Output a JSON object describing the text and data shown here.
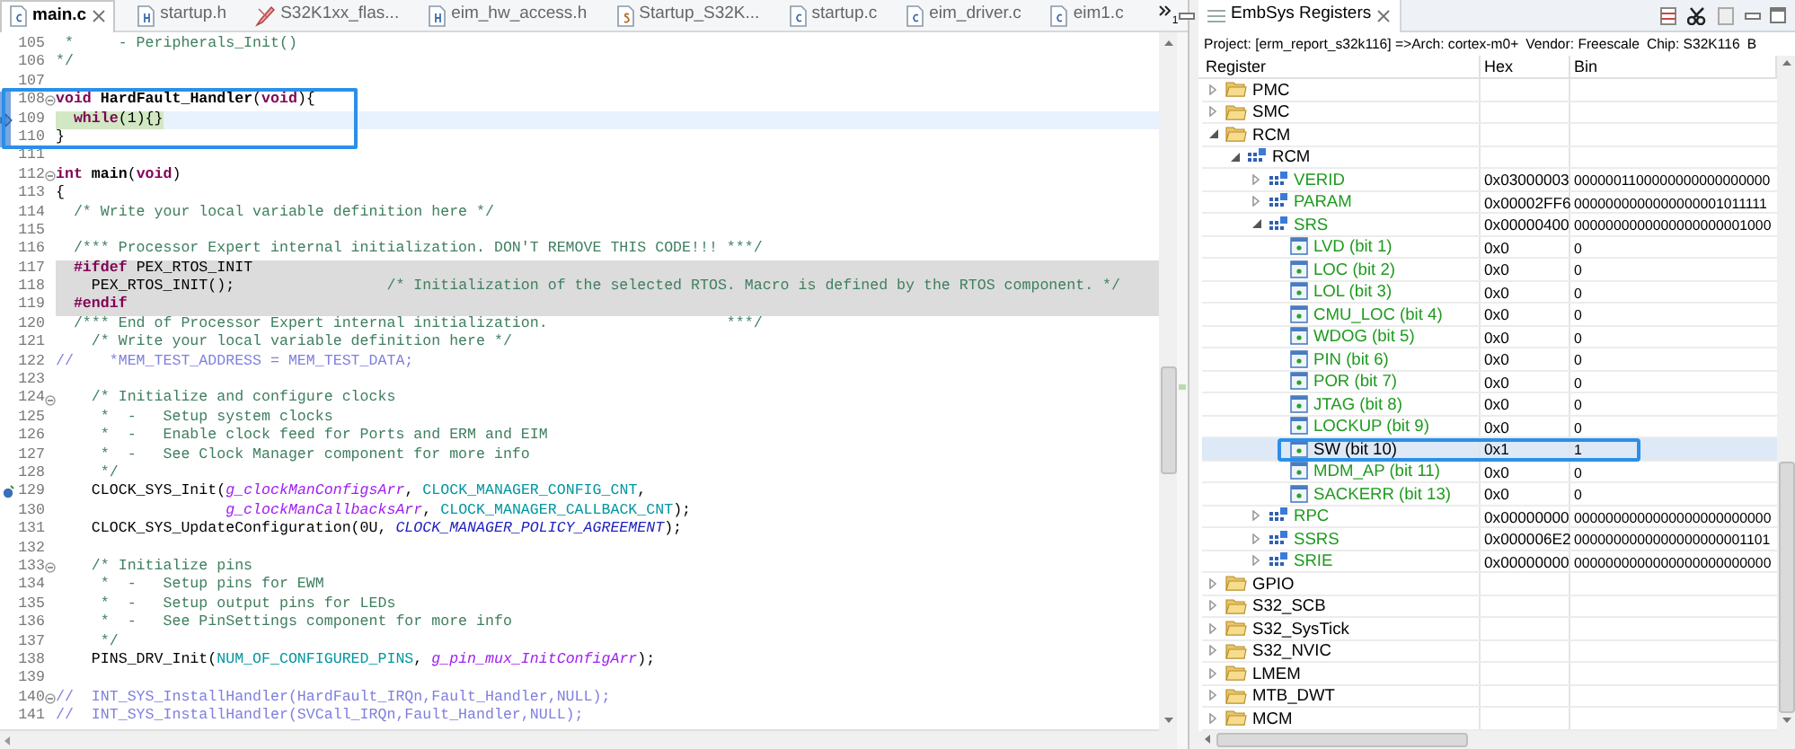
{
  "editor": {
    "tabs": [
      {
        "label": "main.c",
        "kind": "c",
        "selected": true
      },
      {
        "label": "startup.h",
        "kind": "h",
        "selected": false
      },
      {
        "label": "S32K1xx_flas...",
        "kind": "ld",
        "selected": false
      },
      {
        "label": "eim_hw_access.h",
        "kind": "h",
        "selected": false
      },
      {
        "label": "Startup_S32K...",
        "kind": "s",
        "selected": false
      },
      {
        "label": "startup.c",
        "kind": "c",
        "selected": false
      },
      {
        "label": "eim_driver.c",
        "kind": "c",
        "selected": false
      },
      {
        "label": "eim1.c",
        "kind": "c",
        "selected": false
      }
    ],
    "overflow_count": "1",
    "lines": [
      {
        "n": "105",
        "kind": "plain",
        "fold": false,
        "marked": false,
        "tokens": [
          {
            "t": " *     - Peripherals_Init()",
            "kind": "comment"
          }
        ]
      },
      {
        "n": "106",
        "kind": "plain",
        "fold": false,
        "marked": false,
        "tokens": [
          {
            "t": "*/",
            "kind": "comment"
          }
        ]
      },
      {
        "n": "107",
        "kind": "plain",
        "fold": false,
        "marked": false
      },
      {
        "n": "108",
        "kind": "plain",
        "fold": true,
        "marked": true,
        "tokens": [
          {
            "t": "void",
            "kind": "kw"
          },
          {
            "t": " HardFault_Handler",
            "kind": "fn"
          },
          {
            "t": "(",
            "kind": "plain"
          },
          {
            "t": "void",
            "kind": "kw"
          },
          {
            "t": "){",
            "kind": "plain"
          }
        ]
      },
      {
        "n": "109",
        "kind": "current",
        "fold": false,
        "marked": true,
        "marker": {
          "kind": "pointer"
        },
        "tokens": [
          {
            "t": "  while",
            "kind": "kw"
          },
          {
            "t": "(1){}",
            "kind": "plain"
          }
        ]
      },
      {
        "n": "110",
        "kind": "plain",
        "fold": false,
        "marked": true,
        "tokens": [
          {
            "t": "}",
            "kind": "plain"
          }
        ]
      },
      {
        "n": "111",
        "kind": "plain",
        "fold": false,
        "marked": false
      },
      {
        "n": "112",
        "kind": "plain",
        "fold": true,
        "marked": false,
        "tokens": [
          {
            "t": "int",
            "kind": "kw"
          },
          {
            "t": " main",
            "kind": "fn"
          },
          {
            "t": "(",
            "kind": "plain"
          },
          {
            "t": "void",
            "kind": "kw"
          },
          {
            "t": ")",
            "kind": "plain"
          }
        ]
      },
      {
        "n": "113",
        "kind": "plain",
        "fold": false,
        "marked": false,
        "tokens": [
          {
            "t": "{",
            "kind": "plain"
          }
        ]
      },
      {
        "n": "114",
        "kind": "plain",
        "fold": false,
        "marked": false,
        "tokens": [
          {
            "t": "  /* Write your local variable definition here */",
            "kind": "comment"
          }
        ]
      },
      {
        "n": "115",
        "kind": "plain",
        "fold": false,
        "marked": false
      },
      {
        "n": "116",
        "kind": "plain",
        "fold": false,
        "marked": false,
        "tokens": [
          {
            "t": "  /*** Processor Expert internal initialization. DON'T REMOVE THIS CODE!!! ***/",
            "kind": "comment"
          }
        ]
      },
      {
        "n": "117",
        "kind": "inactive",
        "fold": false,
        "marked": false,
        "tokens": [
          {
            "t": "  #ifdef",
            "kind": "pre"
          },
          {
            "t": " PEX_RTOS_INIT",
            "kind": "plain"
          }
        ]
      },
      {
        "n": "118",
        "kind": "inactive",
        "fold": false,
        "marked": false,
        "tokens": [
          {
            "t": "    PEX_RTOS_INIT();                 ",
            "kind": "plain"
          },
          {
            "t": "/* Initialization of the selected RTOS. Macro is defined by the RTOS component. */",
            "kind": "comment"
          }
        ]
      },
      {
        "n": "119",
        "kind": "inactive",
        "fold": false,
        "marked": false,
        "tokens": [
          {
            "t": "  #endif",
            "kind": "pre"
          }
        ]
      },
      {
        "n": "120",
        "kind": "plain",
        "fold": false,
        "marked": false,
        "tokens": [
          {
            "t": "  /*** End of Processor Expert internal initialization.                    ***/",
            "kind": "comment"
          }
        ]
      },
      {
        "n": "121",
        "kind": "plain",
        "fold": false,
        "marked": false,
        "tokens": [
          {
            "t": "    /* Write your local variable definition here */",
            "kind": "comment"
          }
        ]
      },
      {
        "n": "122",
        "kind": "plain",
        "fold": false,
        "marked": false,
        "tokens": [
          {
            "t": "//    *MEM_TEST_ADDRESS = MEM_TEST_DATA;",
            "kind": "linecomment"
          }
        ]
      },
      {
        "n": "123",
        "kind": "plain",
        "fold": false,
        "marked": false
      },
      {
        "n": "124",
        "kind": "plain",
        "fold": true,
        "marked": false,
        "tokens": [
          {
            "t": "    /* Initialize and configure clocks",
            "kind": "comment"
          }
        ]
      },
      {
        "n": "125",
        "kind": "plain",
        "fold": false,
        "marked": false,
        "tokens": [
          {
            "t": "     *  -   Setup system clocks",
            "kind": "comment"
          }
        ]
      },
      {
        "n": "126",
        "kind": "plain",
        "fold": false,
        "marked": false,
        "tokens": [
          {
            "t": "     *  -   Enable clock feed for Ports and ERM and EIM",
            "kind": "comment"
          }
        ]
      },
      {
        "n": "127",
        "kind": "plain",
        "fold": false,
        "marked": false,
        "tokens": [
          {
            "t": "     *  -   See Clock Manager component for more info",
            "kind": "comment"
          }
        ]
      },
      {
        "n": "128",
        "kind": "plain",
        "fold": false,
        "marked": false,
        "tokens": [
          {
            "t": "     */",
            "kind": "comment"
          }
        ]
      },
      {
        "n": "129",
        "kind": "plain",
        "fold": false,
        "marked": false,
        "marker": {
          "kind": "breakpoint"
        },
        "tokens": [
          {
            "t": "    CLOCK_SYS_Init(",
            "kind": "plain"
          },
          {
            "t": "g_clockManConfigsArr",
            "kind": "gvar"
          },
          {
            "t": ", ",
            "kind": "plain"
          },
          {
            "t": "CLOCK_MANAGER_CONFIG_CNT",
            "kind": "macro"
          },
          {
            "t": ",",
            "kind": "plain"
          }
        ]
      },
      {
        "n": "130",
        "kind": "plain",
        "fold": false,
        "marked": false,
        "tokens": [
          {
            "t": "                   g_clockManCallbacksArr",
            "kind": "gvar"
          },
          {
            "t": ", ",
            "kind": "plain"
          },
          {
            "t": "CLOCK_MANAGER_CALLBACK_CNT",
            "kind": "macro"
          },
          {
            "t": ");",
            "kind": "plain"
          }
        ]
      },
      {
        "n": "131",
        "kind": "plain",
        "fold": false,
        "marked": false,
        "tokens": [
          {
            "t": "    CLOCK_SYS_UpdateConfiguration(0U, ",
            "kind": "plain"
          },
          {
            "t": "CLOCK_MANAGER_POLICY_AGREEMENT",
            "kind": "enum"
          },
          {
            "t": ");",
            "kind": "plain"
          }
        ]
      },
      {
        "n": "132",
        "kind": "plain",
        "fold": false,
        "marked": false
      },
      {
        "n": "133",
        "kind": "plain",
        "fold": true,
        "marked": false,
        "tokens": [
          {
            "t": "    /* Initialize pins",
            "kind": "comment"
          }
        ]
      },
      {
        "n": "134",
        "kind": "plain",
        "fold": false,
        "marked": false,
        "tokens": [
          {
            "t": "     *  -   Setup pins for EWM",
            "kind": "comment"
          }
        ]
      },
      {
        "n": "135",
        "kind": "plain",
        "fold": false,
        "marked": false,
        "tokens": [
          {
            "t": "     *  -   Setup output pins for LEDs",
            "kind": "comment"
          }
        ]
      },
      {
        "n": "136",
        "kind": "plain",
        "fold": false,
        "marked": false,
        "tokens": [
          {
            "t": "     *  -   See PinSettings component for more info",
            "kind": "comment"
          }
        ]
      },
      {
        "n": "137",
        "kind": "plain",
        "fold": false,
        "marked": false,
        "tokens": [
          {
            "t": "     */",
            "kind": "comment"
          }
        ]
      },
      {
        "n": "138",
        "kind": "plain",
        "fold": false,
        "marked": false,
        "tokens": [
          {
            "t": "    PINS_DRV_Init(",
            "kind": "plain"
          },
          {
            "t": "NUM_OF_CONFIGURED_PINS",
            "kind": "macro"
          },
          {
            "t": ", ",
            "kind": "plain"
          },
          {
            "t": "g_pin_mux_InitConfigArr",
            "kind": "gvar"
          },
          {
            "t": ");",
            "kind": "plain"
          }
        ]
      },
      {
        "n": "139",
        "kind": "plain",
        "fold": false,
        "marked": false
      },
      {
        "n": "140",
        "kind": "plain",
        "fold": true,
        "marked": false,
        "tokens": [
          {
            "t": "//  INT_SYS_InstallHandler(HardFault_IRQn,Fault_Handler,NULL);",
            "kind": "linecomment"
          }
        ]
      },
      {
        "n": "141",
        "kind": "plain",
        "fold": false,
        "marked": false,
        "tokens": [
          {
            "t": "//  INT_SYS_InstallHandler(SVCall_IRQn,Fault_Handler,NULL);",
            "kind": "linecomment"
          }
        ]
      }
    ]
  },
  "registers": {
    "title": "EmbSys Registers",
    "info": [
      "Project: [erm_report_s32k116] =>Arch: cortex-m0+",
      "Vendor: Freescale",
      "Chip: S32K116",
      "B"
    ],
    "columns": [
      "Register",
      "Hex",
      "Bin"
    ],
    "tree": [
      {
        "name": "PMC",
        "kind": "folder",
        "expanded": false,
        "selected": false
      },
      {
        "name": "SMC",
        "kind": "folder",
        "expanded": false,
        "selected": false
      },
      {
        "name": "RCM",
        "kind": "folder",
        "expanded": true,
        "selected": false,
        "children": [
          {
            "name": "RCM",
            "kind": "peripheral",
            "expanded": true,
            "selected": false,
            "children": [
              {
                "name": "VERID",
                "kind": "register",
                "expanded": false,
                "selected": false,
                "hex": "0x03000003",
                "bin": "0000001100000000000000000"
              },
              {
                "name": "PARAM",
                "kind": "register",
                "expanded": false,
                "selected": false,
                "hex": "0x00002FF6",
                "bin": "0000000000000000001011111"
              },
              {
                "name": "SRS",
                "kind": "register",
                "expanded": true,
                "selected": false,
                "hex": "0x00000400",
                "bin": "0000000000000000000001000",
                "children": [
                  {
                    "name": "LVD (bit 1)",
                    "kind": "field",
                    "selected": false,
                    "hex": "0x0",
                    "bin": "0"
                  },
                  {
                    "name": "LOC (bit 2)",
                    "kind": "field",
                    "selected": false,
                    "hex": "0x0",
                    "bin": "0"
                  },
                  {
                    "name": "LOL (bit 3)",
                    "kind": "field",
                    "selected": false,
                    "hex": "0x0",
                    "bin": "0"
                  },
                  {
                    "name": "CMU_LOC (bit 4)",
                    "kind": "field",
                    "selected": false,
                    "hex": "0x0",
                    "bin": "0"
                  },
                  {
                    "name": "WDOG (bit 5)",
                    "kind": "field",
                    "selected": false,
                    "hex": "0x0",
                    "bin": "0"
                  },
                  {
                    "name": "PIN (bit 6)",
                    "kind": "field",
                    "selected": false,
                    "hex": "0x0",
                    "bin": "0"
                  },
                  {
                    "name": "POR (bit 7)",
                    "kind": "field",
                    "selected": false,
                    "hex": "0x0",
                    "bin": "0"
                  },
                  {
                    "name": "JTAG (bit 8)",
                    "kind": "field",
                    "selected": false,
                    "hex": "0x0",
                    "bin": "0"
                  },
                  {
                    "name": "LOCKUP (bit 9)",
                    "kind": "field",
                    "selected": false,
                    "hex": "0x0",
                    "bin": "0"
                  },
                  {
                    "name": "SW (bit 10)",
                    "kind": "field",
                    "selected": true,
                    "hex": "0x1",
                    "bin": "1"
                  },
                  {
                    "name": "MDM_AP (bit 11)",
                    "kind": "field",
                    "selected": false,
                    "hex": "0x0",
                    "bin": "0"
                  },
                  {
                    "name": "SACKERR (bit 13)",
                    "kind": "field",
                    "selected": false,
                    "hex": "0x0",
                    "bin": "0"
                  }
                ]
              },
              {
                "name": "RPC",
                "kind": "register",
                "expanded": false,
                "selected": false,
                "hex": "0x00000000",
                "bin": "0000000000000000000000000"
              },
              {
                "name": "SSRS",
                "kind": "register",
                "expanded": false,
                "selected": false,
                "hex": "0x000006E2",
                "bin": "0000000000000000000001101"
              },
              {
                "name": "SRIE",
                "kind": "register",
                "expanded": false,
                "selected": false,
                "hex": "0x00000000",
                "bin": "0000000000000000000000000"
              }
            ]
          }
        ]
      },
      {
        "name": "GPIO",
        "kind": "folder",
        "expanded": false,
        "selected": false
      },
      {
        "name": "S32_SCB",
        "kind": "folder",
        "expanded": false,
        "selected": false
      },
      {
        "name": "S32_SysTick",
        "kind": "folder",
        "expanded": false,
        "selected": false
      },
      {
        "name": "S32_NVIC",
        "kind": "folder",
        "expanded": false,
        "selected": false
      },
      {
        "name": "LMEM",
        "kind": "folder",
        "expanded": false,
        "selected": false
      },
      {
        "name": "MTB_DWT",
        "kind": "folder",
        "expanded": false,
        "selected": false
      },
      {
        "name": "MCM",
        "kind": "folder",
        "expanded": false,
        "selected": false
      }
    ]
  }
}
